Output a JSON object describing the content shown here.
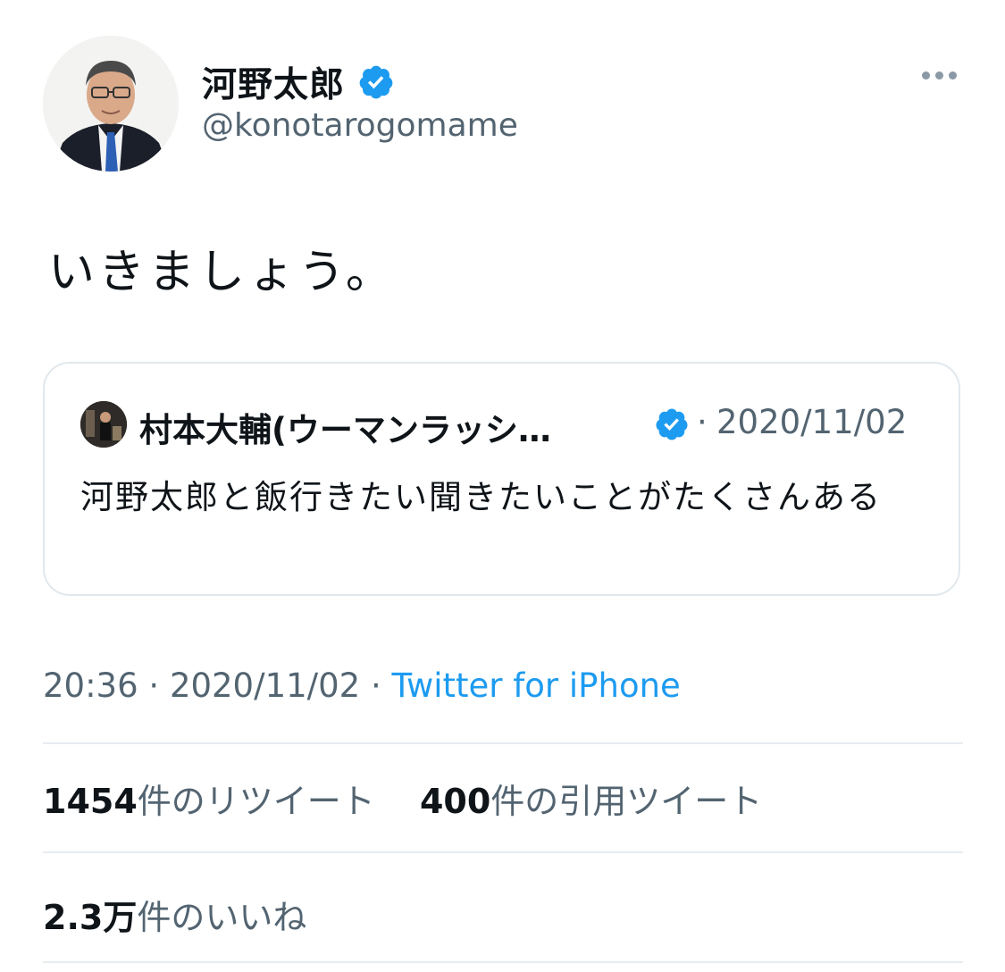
{
  "author": {
    "name": "河野太郎",
    "handle": "@konotarogomame"
  },
  "tweet": {
    "text": "いきましょう。"
  },
  "quoted_tweet": {
    "name": "村本大輔(ウーマンラッシ…",
    "separator": "·",
    "date": "2020/11/02",
    "text": "河野太郎と飯行きたい聞きたいことがたくさんある"
  },
  "meta": {
    "time": "20:36",
    "sep1": " · ",
    "date": "2020/11/02",
    "sep2": " · ",
    "source": "Twitter for iPhone"
  },
  "stats": {
    "retweets_count": "1454",
    "retweets_label": "件のリツイート",
    "quotes_count": "400",
    "quotes_label": "件の引用ツイート",
    "likes_count": "2.3万",
    "likes_label": "件のいいね"
  },
  "icons": {
    "verified": "verified-badge-icon",
    "more": "more-options-icon"
  },
  "colors": {
    "accent": "#1d9bf0",
    "muted": "#536471",
    "text": "#0f1419"
  }
}
